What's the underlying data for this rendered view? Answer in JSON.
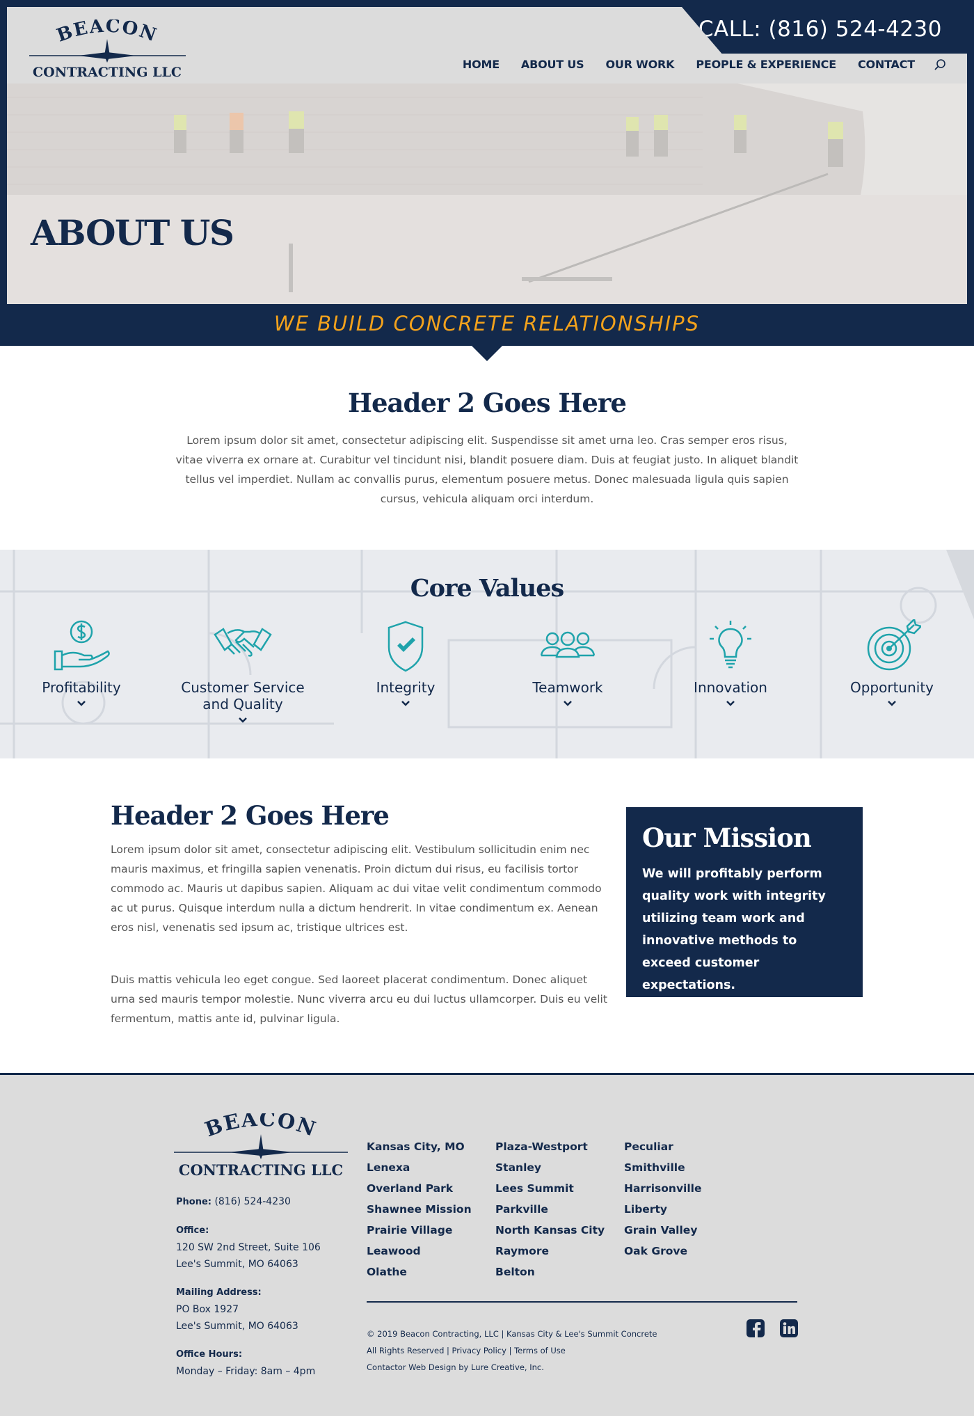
{
  "header": {
    "phone_label": "CALL: (816) 524-4230",
    "logo": {
      "line1": "BEACON",
      "line2": "CONTRACTING LLC"
    },
    "nav": [
      "HOME",
      "ABOUT US",
      "OUR WORK",
      "PEOPLE & EXPERIENCE",
      "CONTACT"
    ]
  },
  "hero": {
    "title": "ABOUT US"
  },
  "tagline": "WE BUILD CONCRETE RELATIONSHIPS",
  "intro": {
    "title": "Header 2 Goes Here",
    "text": "Lorem ipsum dolor sit amet, consectetur adipiscing elit. Suspendisse sit amet urna leo. Cras semper eros risus, vitae viverra ex ornare at. Curabitur vel tincidunt nisi, blandit posuere diam. Duis at feugiat justo. In aliquet blandit tellus vel imperdiet. Nullam ac convallis purus, elementum posuere metus. Donec malesuada ligula quis sapien cursus, vehicula aliquam orci interdum."
  },
  "core_values": {
    "title": "Core Values",
    "items": [
      {
        "label": "Profitability",
        "icon": "hand-dollar-icon"
      },
      {
        "label": "Customer Service and Quality",
        "icon": "handshake-icon"
      },
      {
        "label": "Integrity",
        "icon": "shield-check-icon"
      },
      {
        "label": "Teamwork",
        "icon": "team-icon"
      },
      {
        "label": "Innovation",
        "icon": "lightbulb-icon"
      },
      {
        "label": "Opportunity",
        "icon": "target-icon"
      }
    ],
    "accent": "#1fa3ab"
  },
  "content": {
    "title": "Header 2 Goes Here",
    "para1": "Lorem ipsum dolor sit amet, consectetur adipiscing elit. Vestibulum sollicitudin enim nec mauris maximus, et fringilla sapien venenatis. Proin dictum dui risus, eu facilisis tortor commodo ac. Mauris ut dapibus sapien. Aliquam ac dui vitae velit condimentum commodo ac ut purus. Quisque interdum nulla a dictum hendrerit. In vitae condimentum ex. Aenean eros nisl, venenatis sed ipsum ac, tristique ultrices est.",
    "para2": "Duis mattis vehicula leo eget congue. Sed laoreet placerat condimentum. Donec aliquet urna sed mauris tempor molestie. Nunc viverra arcu eu dui luctus ullamcorper. Duis eu velit fermentum, mattis ante id, pulvinar ligula."
  },
  "mission": {
    "title": "Our Mission",
    "text": "We will profitably perform quality work with integrity utilizing team work and innovative methods to exceed customer expectations."
  },
  "footer": {
    "logo": {
      "line1": "BEACON",
      "line2": "CONTRACTING LLC"
    },
    "phone_label": "Phone:",
    "phone": "(816) 524-4230",
    "office_label": "Office:",
    "office_line1": "120 SW 2nd Street, Suite 106",
    "office_line2": "Lee's Summit, MO 64063",
    "mailing_label": "Mailing Address:",
    "mailing_line1": "PO Box 1927",
    "mailing_line2": "Lee's Summit, MO 64063",
    "hours_label": "Office Hours:",
    "hours": "Monday – Friday: 8am – 4pm",
    "cities_col1": [
      "Kansas City, MO",
      "Lenexa",
      "Overland Park",
      "Shawnee Mission",
      "Prairie Village",
      "Leawood",
      "Olathe"
    ],
    "cities_col2": [
      "Plaza-Westport",
      "Stanley",
      "Lees Summit",
      "Parkville",
      "North Kansas City",
      "Raymore",
      "Belton"
    ],
    "cities_col3": [
      "Peculiar",
      "Smithville",
      "Harrisonville",
      "Liberty",
      "Grain Valley",
      "Oak Grove"
    ],
    "copyright": "© 2019 Beacon Contracting, LLC | Kansas City & Lee's Summit Concrete",
    "rights": "All Rights Reserved | Privacy Policy | Terms of Use",
    "credit": "Contactor Web Design by Lure Creative, Inc.",
    "social": [
      "facebook-icon",
      "linkedin-icon"
    ]
  },
  "colors": {
    "navy": "#13294b",
    "orange": "#f3a21c",
    "teal": "#1fa3ab",
    "grey": "#dcdcdc"
  }
}
